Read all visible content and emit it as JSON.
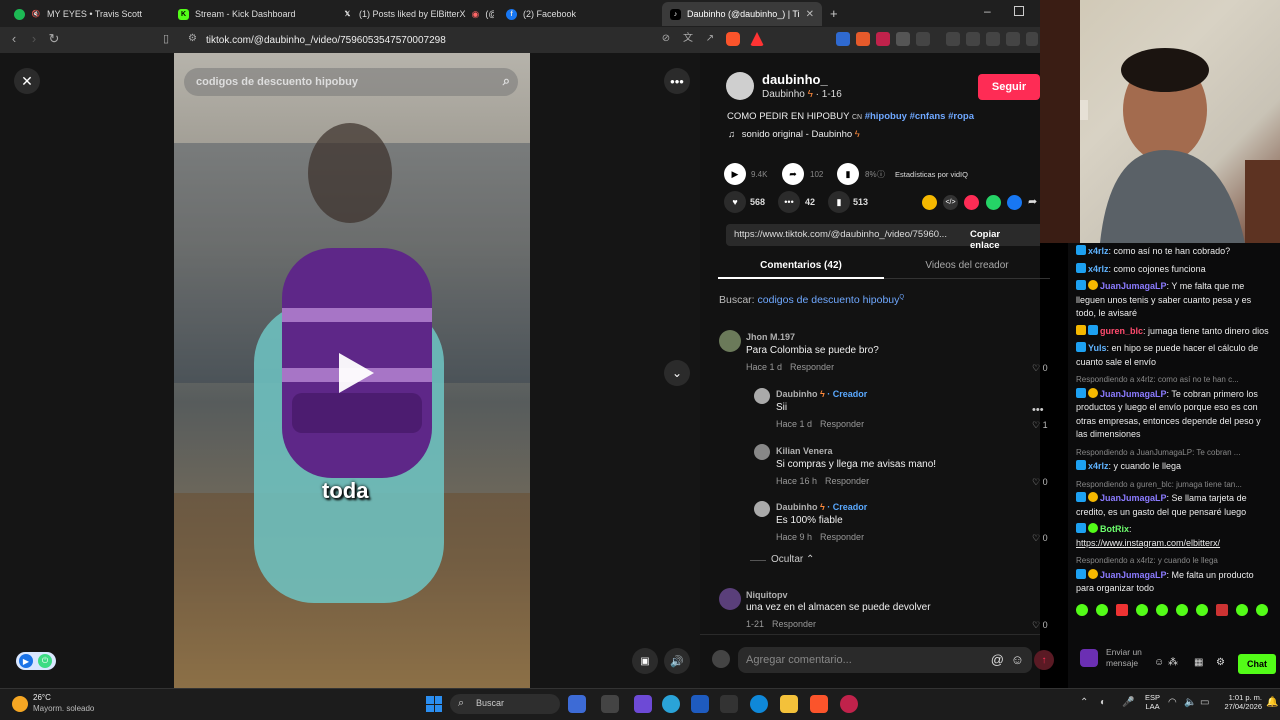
{
  "tabs": [
    {
      "title": "MY EYES • Travis Scott"
    },
    {
      "title": "Stream - Kick Dashboard"
    },
    {
      "title": "(1) Posts liked by ElBitterX",
      "extra": "(@ElBi"
    },
    {
      "title": "(2) Facebook"
    },
    {
      "title": "Daubinho (@daubinho_) | Ti"
    }
  ],
  "new_tab": "+",
  "url": "tiktok.com/@daubinho_/video/7596053547570007298",
  "video": {
    "search_text": "codigos de descuento hipobuy",
    "subtitle": "toda"
  },
  "author": {
    "handle": "daubinho_",
    "name": "Daubinho",
    "date": "· 1-16",
    "follow_label": "Seguir",
    "caption": "COMO PEDIR EN HIPOBUY",
    "caption_tags": "#hipobuy #cnfans #ropa",
    "caption_emoji": "CN",
    "sound": "sonido original - Daubinho"
  },
  "stats": {
    "plays": "9.4K",
    "shares_small": "102",
    "percent": "8%",
    "vidiq_label": "Estadísticas por vidIQ",
    "likes": "568",
    "comments": "42",
    "saves": "513"
  },
  "link": {
    "url": "https://www.tiktok.com/@daubinho_/video/75960...",
    "copy_label": "Copiar enlace"
  },
  "panel_tabs": {
    "comments": "Comentarios (42)",
    "videos": "Videos del creador"
  },
  "search_row": {
    "label": "Buscar:",
    "query": "codigos de descuento hipobuy",
    "suffix": "Q"
  },
  "comments": [
    {
      "name": "Jhon M.197",
      "text": "Para Colombia se puede bro?",
      "time": "Hace 1 d",
      "reply": "Responder",
      "likes": "0"
    },
    {
      "name": "Daubinho",
      "creator": "· Creador",
      "text": "Sii",
      "time": "Hace 1 d",
      "reply": "Responder",
      "likes": "1"
    },
    {
      "name": "Kilian Venera",
      "text": "Si compras y llega me avisas mano!",
      "time": "Hace 16 h",
      "reply": "Responder",
      "likes": "0"
    },
    {
      "name": "Daubinho",
      "creator": "· Creador",
      "text": "Es 100% fiable",
      "time": "Hace 9 h",
      "reply": "Responder",
      "likes": "0"
    },
    {
      "name": "Niquitopv",
      "text": "una vez en el almacen se puede devolver",
      "time": "1-21",
      "reply": "Responder",
      "likes": "0"
    }
  ],
  "hide_label": "Ocultar",
  "add_comment_placeholder": "Agregar comentario...",
  "chat": {
    "lines": [
      {
        "reply": "",
        "user": "x4rlz",
        "color": "#5fb3ff",
        "text": ": como así no te han cobrado?"
      },
      {
        "reply": "",
        "user": "x4rlz",
        "color": "#5fb3ff",
        "text": ": como cojones funciona"
      },
      {
        "reply": "",
        "user": "JuanJumagaLP",
        "color": "#8b7bff",
        "text": ": Y me falta que me lleguen unos tenis y saber cuanto pesa y es todo, le avisaré"
      },
      {
        "reply": "",
        "user": "guren_blc",
        "color": "#ff4b6e",
        "text": ": jumaga tiene tanto dinero dios"
      },
      {
        "reply": "",
        "user": "Yuls",
        "color": "#5fb3ff",
        "text": ": en hipo se puede hacer el cálculo de cuanto sale el envío"
      },
      {
        "reply": "Respondiendo a x4rlz: como así no te han c...",
        "user": "JuanJumagaLP",
        "color": "#8b7bff",
        "text": ": Te cobran primero los productos y luego el envío porque eso es con otras empresas, entonces depende del peso y las dimensiones"
      },
      {
        "reply": "Respondiendo a JuanJumagaLP: Te cobran ...",
        "user": "x4rlz",
        "color": "#5fb3ff",
        "text": ": y cuando le llega"
      },
      {
        "reply": "Respondiendo a guren_blc: jumaga tiene tan...",
        "user": "JuanJumagaLP",
        "color": "#8b7bff",
        "text": ": Se llama tarjeta de credito, es un gasto del que pensaré luego"
      },
      {
        "reply": "",
        "user": "BotRix",
        "color": "#6dff6d",
        "text": ":"
      },
      {
        "reply": "",
        "user": "",
        "color": "#fff",
        "text": "https://www.instagram.com/elbitterx/"
      },
      {
        "reply": "Respondiendo a x4rlz: y cuando le llega",
        "user": "JuanJumagaLP",
        "color": "#8b7bff",
        "text": ": Me falta un producto para organizar todo"
      }
    ],
    "send_label": "Enviar un mensaje",
    "chat_button": "Chat"
  },
  "taskbar": {
    "temp": "26°C",
    "weather": "Mayorm. soleado",
    "search": "Buscar",
    "lang1": "ESP",
    "lang2": "LAA",
    "time": "1:01 p. m.",
    "date": "27/04/2026"
  },
  "colors": {
    "accent": "#fe2c55",
    "link": "#6fa8ff",
    "kick_green": "#53fc18"
  }
}
